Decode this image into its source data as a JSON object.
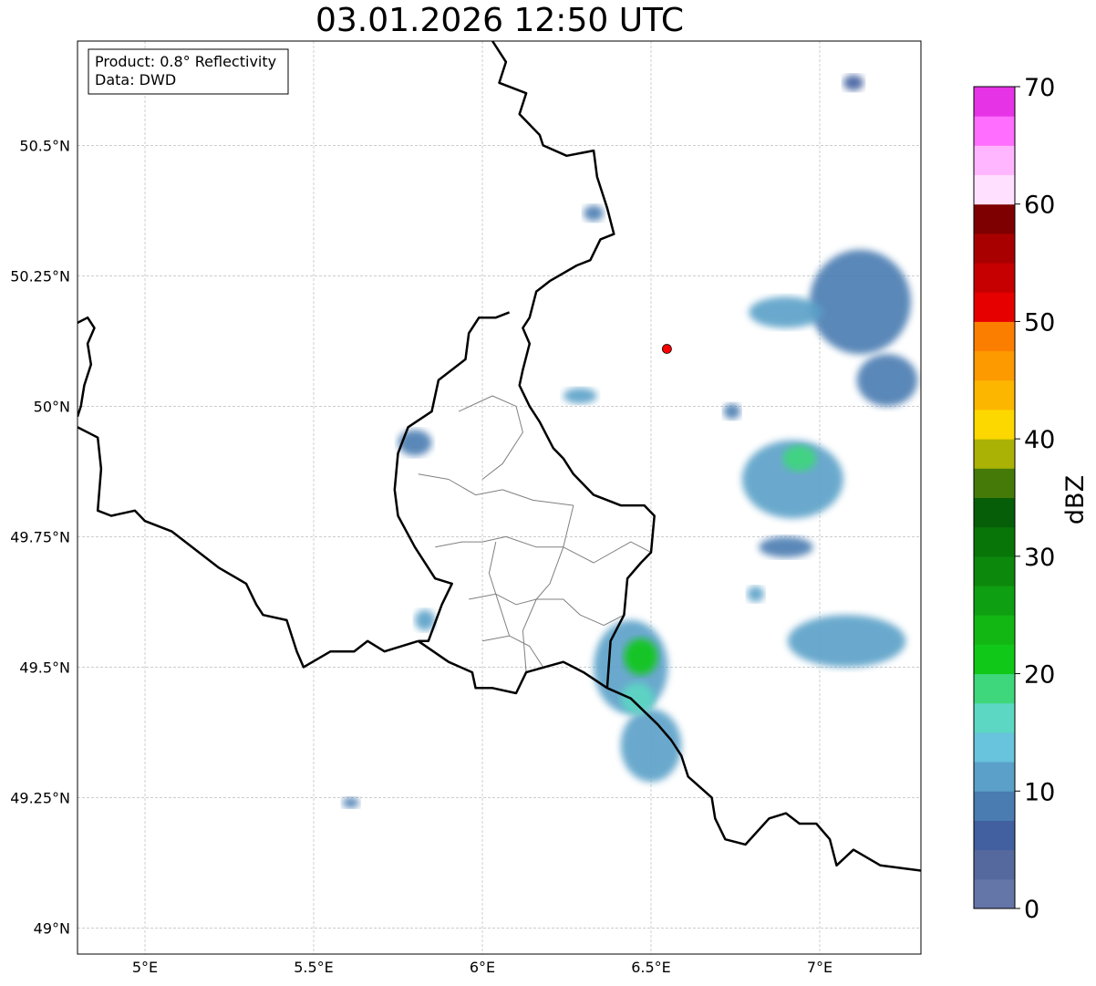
{
  "title": "03.01.2026 12:50 UTC",
  "info": {
    "product": "Product: 0.8° Reflectivity",
    "data": "Data: DWD"
  },
  "axes": {
    "lon_range": [
      4.8,
      7.3
    ],
    "lat_range": [
      48.95,
      50.7
    ],
    "lon_ticks": [
      {
        "value": 5.0,
        "label": "5°E"
      },
      {
        "value": 5.5,
        "label": "5.5°E"
      },
      {
        "value": 6.0,
        "label": "6°E"
      },
      {
        "value": 6.5,
        "label": "6.5°E"
      },
      {
        "value": 7.0,
        "label": "7°E"
      }
    ],
    "lat_ticks": [
      {
        "value": 50.5,
        "label": "50.5°N"
      },
      {
        "value": 50.25,
        "label": "50.25°N"
      },
      {
        "value": 50.0,
        "label": "50°N"
      },
      {
        "value": 49.75,
        "label": "49.75°N"
      },
      {
        "value": 49.5,
        "label": "49.5°N"
      },
      {
        "value": 49.25,
        "label": "49.25°N"
      },
      {
        "value": 49.0,
        "label": "49°N"
      }
    ],
    "grid": true
  },
  "radar_site": {
    "lon": 6.547,
    "lat": 50.11,
    "color": "#ff0000"
  },
  "colorbar": {
    "label": "dBZ",
    "range": [
      0,
      70
    ],
    "ticks": [
      {
        "value": 0,
        "label": "0"
      },
      {
        "value": 10,
        "label": "10"
      },
      {
        "value": 20,
        "label": "20"
      },
      {
        "value": 30,
        "label": "30"
      },
      {
        "value": 40,
        "label": "40"
      },
      {
        "value": 50,
        "label": "50"
      },
      {
        "value": 60,
        "label": "60"
      },
      {
        "value": 70,
        "label": "70"
      }
    ],
    "colors": [
      "#6475a8",
      "#56699e",
      "#42609f",
      "#4a7bb1",
      "#5aa0c8",
      "#68c3dc",
      "#5cd7c3",
      "#3ed77c",
      "#10c818",
      "#12b714",
      "#0f9f12",
      "#0c880c",
      "#087508",
      "#065e08",
      "#467a08",
      "#abb206",
      "#fcd700",
      "#fcb600",
      "#fc9a00",
      "#fc7e00",
      "#e60000",
      "#c60000",
      "#a80000",
      "#7e0000",
      "#ffe0ff",
      "#ffb6ff",
      "#ff6eff",
      "#e633e6"
    ]
  },
  "borders": {
    "germany_belgium_lux": [
      [
        6.03,
        50.7
      ],
      [
        6.07,
        50.66
      ],
      [
        6.05,
        50.62
      ],
      [
        6.13,
        50.6
      ],
      [
        6.11,
        50.56
      ],
      [
        6.17,
        50.52
      ],
      [
        6.18,
        50.5
      ],
      [
        6.25,
        50.48
      ],
      [
        6.33,
        50.49
      ],
      [
        6.34,
        50.44
      ],
      [
        6.37,
        50.38
      ],
      [
        6.39,
        50.33
      ],
      [
        6.35,
        50.32
      ],
      [
        6.32,
        50.28
      ],
      [
        6.28,
        50.27
      ],
      [
        6.2,
        50.24
      ],
      [
        6.16,
        50.22
      ],
      [
        6.14,
        50.17
      ],
      [
        6.12,
        50.15
      ],
      [
        6.14,
        50.12
      ],
      [
        6.12,
        50.07
      ],
      [
        6.11,
        50.04
      ],
      [
        6.14,
        50.0
      ],
      [
        6.17,
        49.97
      ],
      [
        6.21,
        49.92
      ],
      [
        6.24,
        49.9
      ],
      [
        6.27,
        49.87
      ],
      [
        6.33,
        49.83
      ],
      [
        6.41,
        49.81
      ],
      [
        6.48,
        49.81
      ],
      [
        6.51,
        49.79
      ],
      [
        6.5,
        49.72
      ],
      [
        6.47,
        49.7
      ],
      [
        6.43,
        49.67
      ],
      [
        6.42,
        49.6
      ],
      [
        6.38,
        49.55
      ],
      [
        6.37,
        49.46
      ]
    ],
    "belgium_lux_fr": [
      [
        6.08,
        50.18
      ],
      [
        6.04,
        50.17
      ],
      [
        5.99,
        50.17
      ],
      [
        5.96,
        50.14
      ],
      [
        5.95,
        50.09
      ],
      [
        5.87,
        50.05
      ],
      [
        5.85,
        49.99
      ],
      [
        5.78,
        49.96
      ],
      [
        5.75,
        49.91
      ],
      [
        5.74,
        49.84
      ],
      [
        5.75,
        49.79
      ],
      [
        5.8,
        49.73
      ],
      [
        5.86,
        49.67
      ],
      [
        5.91,
        49.66
      ],
      [
        5.88,
        49.62
      ],
      [
        5.84,
        49.55
      ],
      [
        5.81,
        49.55
      ]
    ],
    "lux_fr_de": [
      [
        5.81,
        49.55
      ],
      [
        5.9,
        49.51
      ],
      [
        5.97,
        49.49
      ],
      [
        5.98,
        49.46
      ],
      [
        6.03,
        49.46
      ],
      [
        6.1,
        49.45
      ],
      [
        6.13,
        49.49
      ],
      [
        6.24,
        49.51
      ],
      [
        6.3,
        49.49
      ],
      [
        6.37,
        49.46
      ]
    ],
    "belgium_france": [
      [
        4.8,
        49.96
      ],
      [
        4.86,
        49.94
      ],
      [
        4.87,
        49.88
      ],
      [
        4.86,
        49.8
      ],
      [
        4.9,
        49.79
      ],
      [
        4.97,
        49.8
      ],
      [
        5.0,
        49.78
      ],
      [
        5.08,
        49.76
      ],
      [
        5.16,
        49.72
      ],
      [
        5.22,
        49.69
      ],
      [
        5.3,
        49.66
      ],
      [
        5.33,
        49.62
      ],
      [
        5.35,
        49.6
      ],
      [
        5.42,
        49.59
      ],
      [
        5.45,
        49.53
      ],
      [
        5.47,
        49.5
      ],
      [
        5.55,
        49.53
      ],
      [
        5.62,
        49.53
      ],
      [
        5.66,
        49.55
      ],
      [
        5.71,
        49.53
      ],
      [
        5.81,
        49.55
      ]
    ],
    "france_germany": [
      [
        6.37,
        49.46
      ],
      [
        6.44,
        49.44
      ],
      [
        6.52,
        49.39
      ],
      [
        6.56,
        49.36
      ],
      [
        6.59,
        49.33
      ],
      [
        6.61,
        49.29
      ],
      [
        6.68,
        49.25
      ],
      [
        6.69,
        49.21
      ],
      [
        6.72,
        49.17
      ],
      [
        6.78,
        49.16
      ],
      [
        6.85,
        49.21
      ],
      [
        6.9,
        49.22
      ],
      [
        6.94,
        49.2
      ],
      [
        6.99,
        49.2
      ],
      [
        7.03,
        49.17
      ],
      [
        7.05,
        49.12
      ],
      [
        7.1,
        49.15
      ],
      [
        7.18,
        49.12
      ],
      [
        7.3,
        49.11
      ]
    ],
    "belgium_nl_top": [
      [
        4.8,
        50.16
      ],
      [
        4.83,
        50.17
      ],
      [
        4.85,
        50.15
      ],
      [
        4.83,
        50.12
      ],
      [
        4.84,
        50.08
      ],
      [
        4.82,
        50.04
      ],
      [
        4.81,
        50.0
      ],
      [
        4.8,
        49.98
      ]
    ],
    "cantons": [
      [
        [
          5.93,
          49.99
        ],
        [
          6.03,
          50.02
        ],
        [
          6.1,
          50.0
        ],
        [
          6.12,
          49.95
        ],
        [
          6.06,
          49.89
        ],
        [
          6.0,
          49.86
        ]
      ],
      [
        [
          5.81,
          49.87
        ],
        [
          5.9,
          49.86
        ],
        [
          5.98,
          49.83
        ],
        [
          6.06,
          49.84
        ],
        [
          6.15,
          49.82
        ],
        [
          6.27,
          49.81
        ]
      ],
      [
        [
          5.86,
          49.73
        ],
        [
          5.94,
          49.74
        ],
        [
          6.0,
          49.74
        ],
        [
          6.07,
          49.75
        ],
        [
          6.16,
          49.73
        ],
        [
          6.24,
          49.73
        ],
        [
          6.33,
          49.7
        ],
        [
          6.44,
          49.74
        ],
        [
          6.5,
          49.72
        ]
      ],
      [
        [
          5.96,
          49.63
        ],
        [
          6.04,
          49.64
        ],
        [
          6.1,
          49.62
        ],
        [
          6.16,
          49.63
        ],
        [
          6.24,
          49.63
        ],
        [
          6.29,
          49.6
        ],
        [
          6.36,
          49.58
        ],
        [
          6.42,
          49.6
        ]
      ],
      [
        [
          6.0,
          49.55
        ],
        [
          6.08,
          49.56
        ],
        [
          6.14,
          49.54
        ],
        [
          6.18,
          49.5
        ]
      ],
      [
        [
          6.04,
          49.74
        ],
        [
          6.02,
          49.68
        ],
        [
          6.05,
          49.62
        ],
        [
          6.08,
          49.56
        ]
      ],
      [
        [
          6.27,
          49.81
        ],
        [
          6.24,
          49.73
        ],
        [
          6.2,
          49.66
        ],
        [
          6.16,
          49.63
        ],
        [
          6.12,
          49.57
        ],
        [
          6.13,
          49.49
        ]
      ]
    ]
  },
  "echoes": [
    {
      "lon": 6.44,
      "lat": 49.5,
      "w": 0.22,
      "h": 0.18,
      "level": 4
    },
    {
      "lon": 6.47,
      "lat": 49.52,
      "w": 0.1,
      "h": 0.07,
      "level": 8
    },
    {
      "lon": 6.5,
      "lat": 49.35,
      "w": 0.18,
      "h": 0.14,
      "level": 4
    },
    {
      "lon": 6.46,
      "lat": 49.44,
      "w": 0.1,
      "h": 0.06,
      "level": 6
    },
    {
      "lon": 6.92,
      "lat": 49.86,
      "w": 0.3,
      "h": 0.15,
      "level": 4
    },
    {
      "lon": 6.94,
      "lat": 49.9,
      "w": 0.1,
      "h": 0.05,
      "level": 7
    },
    {
      "lon": 7.08,
      "lat": 49.55,
      "w": 0.35,
      "h": 0.1,
      "level": 4
    },
    {
      "lon": 7.12,
      "lat": 50.2,
      "w": 0.3,
      "h": 0.2,
      "level": 3
    },
    {
      "lon": 6.9,
      "lat": 50.18,
      "w": 0.22,
      "h": 0.06,
      "level": 4
    },
    {
      "lon": 7.2,
      "lat": 50.05,
      "w": 0.18,
      "h": 0.1,
      "level": 3
    },
    {
      "lon": 6.29,
      "lat": 50.02,
      "w": 0.1,
      "h": 0.03,
      "level": 4
    },
    {
      "lon": 5.8,
      "lat": 49.93,
      "w": 0.1,
      "h": 0.05,
      "level": 3
    },
    {
      "lon": 5.83,
      "lat": 49.59,
      "w": 0.06,
      "h": 0.04,
      "level": 4
    },
    {
      "lon": 6.33,
      "lat": 50.37,
      "w": 0.06,
      "h": 0.03,
      "level": 3
    },
    {
      "lon": 5.61,
      "lat": 49.24,
      "w": 0.05,
      "h": 0.02,
      "level": 3
    },
    {
      "lon": 7.1,
      "lat": 50.62,
      "w": 0.06,
      "h": 0.03,
      "level": 2
    },
    {
      "lon": 6.74,
      "lat": 49.99,
      "w": 0.05,
      "h": 0.03,
      "level": 3
    },
    {
      "lon": 6.9,
      "lat": 49.73,
      "w": 0.16,
      "h": 0.04,
      "level": 3
    },
    {
      "lon": 6.81,
      "lat": 49.64,
      "w": 0.05,
      "h": 0.03,
      "level": 4
    }
  ]
}
